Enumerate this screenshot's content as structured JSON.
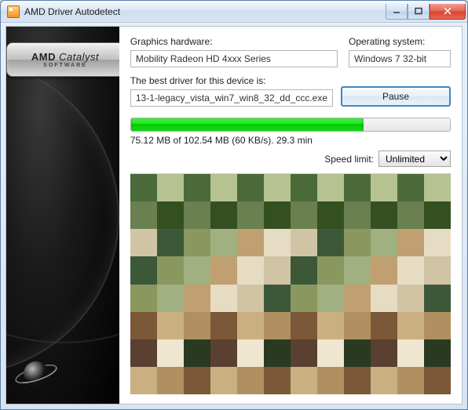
{
  "window": {
    "title": "AMD Driver Autodetect"
  },
  "sidebar": {
    "logo_main": "AMD Catalyst",
    "logo_prefix": "AMD",
    "logo_suffix": "Catalyst",
    "logo_sub": "SOFTWARE"
  },
  "fields": {
    "graphics_label": "Graphics hardware:",
    "graphics_value": "Mobility Radeon HD 4xxx Series",
    "os_label": "Operating system:",
    "os_value": "Windows 7 32-bit",
    "driver_label": "The best driver for this device is:",
    "driver_value": "13-1-legacy_vista_win7_win8_32_dd_ccc.exe",
    "pause_label": "Pause"
  },
  "download": {
    "done_mb": 75.12,
    "total_mb": 102.54,
    "speed_kbs": 60,
    "eta_min": 29.3,
    "percent": 73,
    "status_text": "75.12 MB of 102.54 MB (60 KB/s). 29.3 min"
  },
  "speed_limit": {
    "label": "Speed limit:",
    "value": "Unlimited"
  },
  "colors": {
    "progress_green": "#17e217",
    "accent_blue": "#3c87c7"
  }
}
